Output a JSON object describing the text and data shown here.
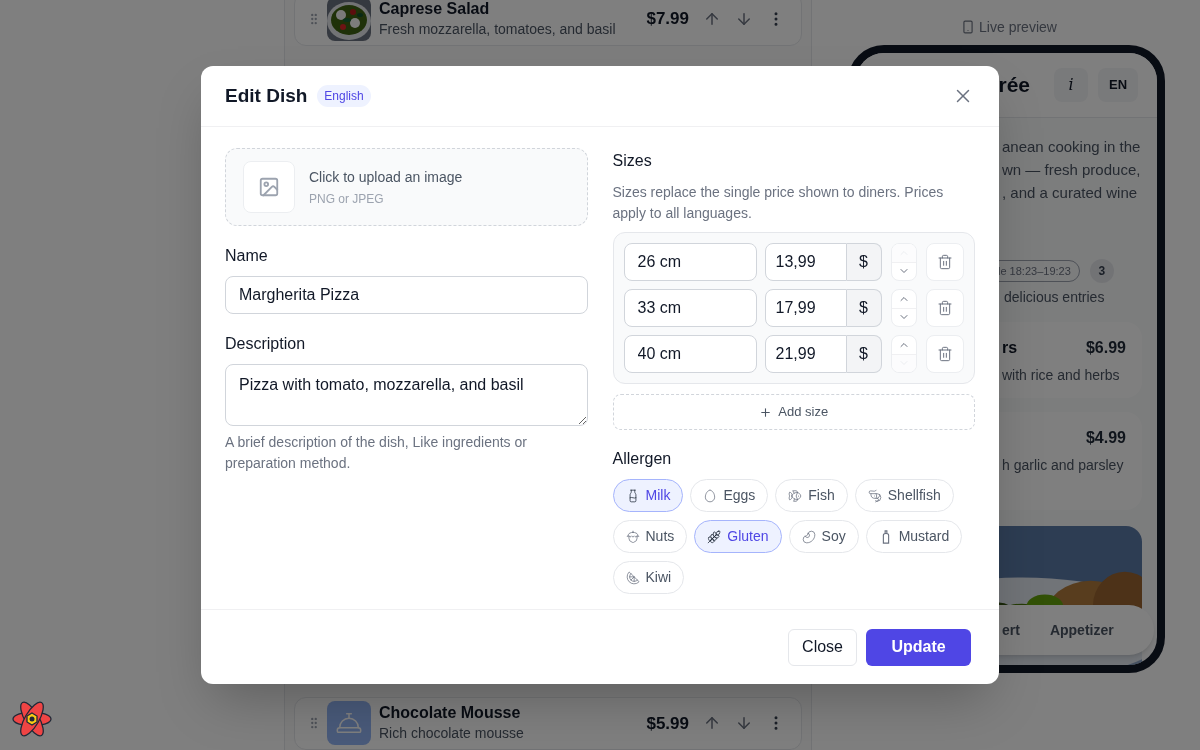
{
  "background": {
    "dishes": [
      {
        "name": "Caprese Salad",
        "description": "Fresh mozzarella, tomatoes, and basil",
        "price": "$7.99",
        "thumb": {
          "kind": "picture"
        }
      },
      {
        "name": "Chocolate Mousse",
        "description": "Rich chocolate mousse",
        "price": "$5.99",
        "thumb": {
          "kind": "icon"
        }
      }
    ],
    "preview": {
      "label": "Live preview",
      "title": "rée",
      "info_button": "i",
      "language_button": "EN",
      "intro_lines": [
        "anean cooking in the",
        "wn — fresh produce,",
        ", and a curated wine"
      ],
      "schedule_chip": "le 18:23–19:23",
      "count": "3",
      "entries_text": "delicious entries",
      "items": [
        {
          "name": "rs",
          "price": "$6.99",
          "description": "with rice and herbs"
        },
        {
          "price": "$4.99",
          "description": "h garlic and parsley"
        }
      ],
      "image": {
        "kind": "picture"
      },
      "nav": [
        "ert",
        "Appetizer"
      ]
    }
  },
  "dialog": {
    "title": "Edit Dish",
    "language_badge": "English",
    "upload": {
      "title": "Click to upload an image",
      "hint": "PNG or JPEG"
    },
    "name": {
      "label": "Name",
      "value": "Margherita Pizza"
    },
    "description": {
      "label": "Description",
      "value": "Pizza with tomato, mozzarella, and basil",
      "hint": "A brief description of the dish, Like ingredients or preparation method."
    },
    "sizes": {
      "label": "Sizes",
      "hint": "Sizes replace the single price shown to diners. Prices apply to all languages.",
      "rows": [
        {
          "name": "26 cm",
          "price": "13,99",
          "currency": "$",
          "up_disabled": true,
          "down_disabled": false
        },
        {
          "name": "33 cm",
          "price": "17,99",
          "currency": "$",
          "up_disabled": false,
          "down_disabled": false
        },
        {
          "name": "40 cm",
          "price": "21,99",
          "currency": "$",
          "up_disabled": false,
          "down_disabled": true
        }
      ],
      "add_button": "Add size"
    },
    "allergens": {
      "label": "Allergen",
      "items": [
        {
          "label": "Milk",
          "selected": true
        },
        {
          "label": "Eggs",
          "selected": false
        },
        {
          "label": "Fish",
          "selected": false
        },
        {
          "label": "Shellfish",
          "selected": false
        },
        {
          "label": "Nuts",
          "selected": false
        },
        {
          "label": "Gluten",
          "selected": true
        },
        {
          "label": "Soy",
          "selected": false
        },
        {
          "label": "Mustard",
          "selected": false
        },
        {
          "label": "Kiwi",
          "selected": false
        }
      ]
    },
    "buttons": {
      "close": "Close",
      "update": "Update"
    }
  }
}
